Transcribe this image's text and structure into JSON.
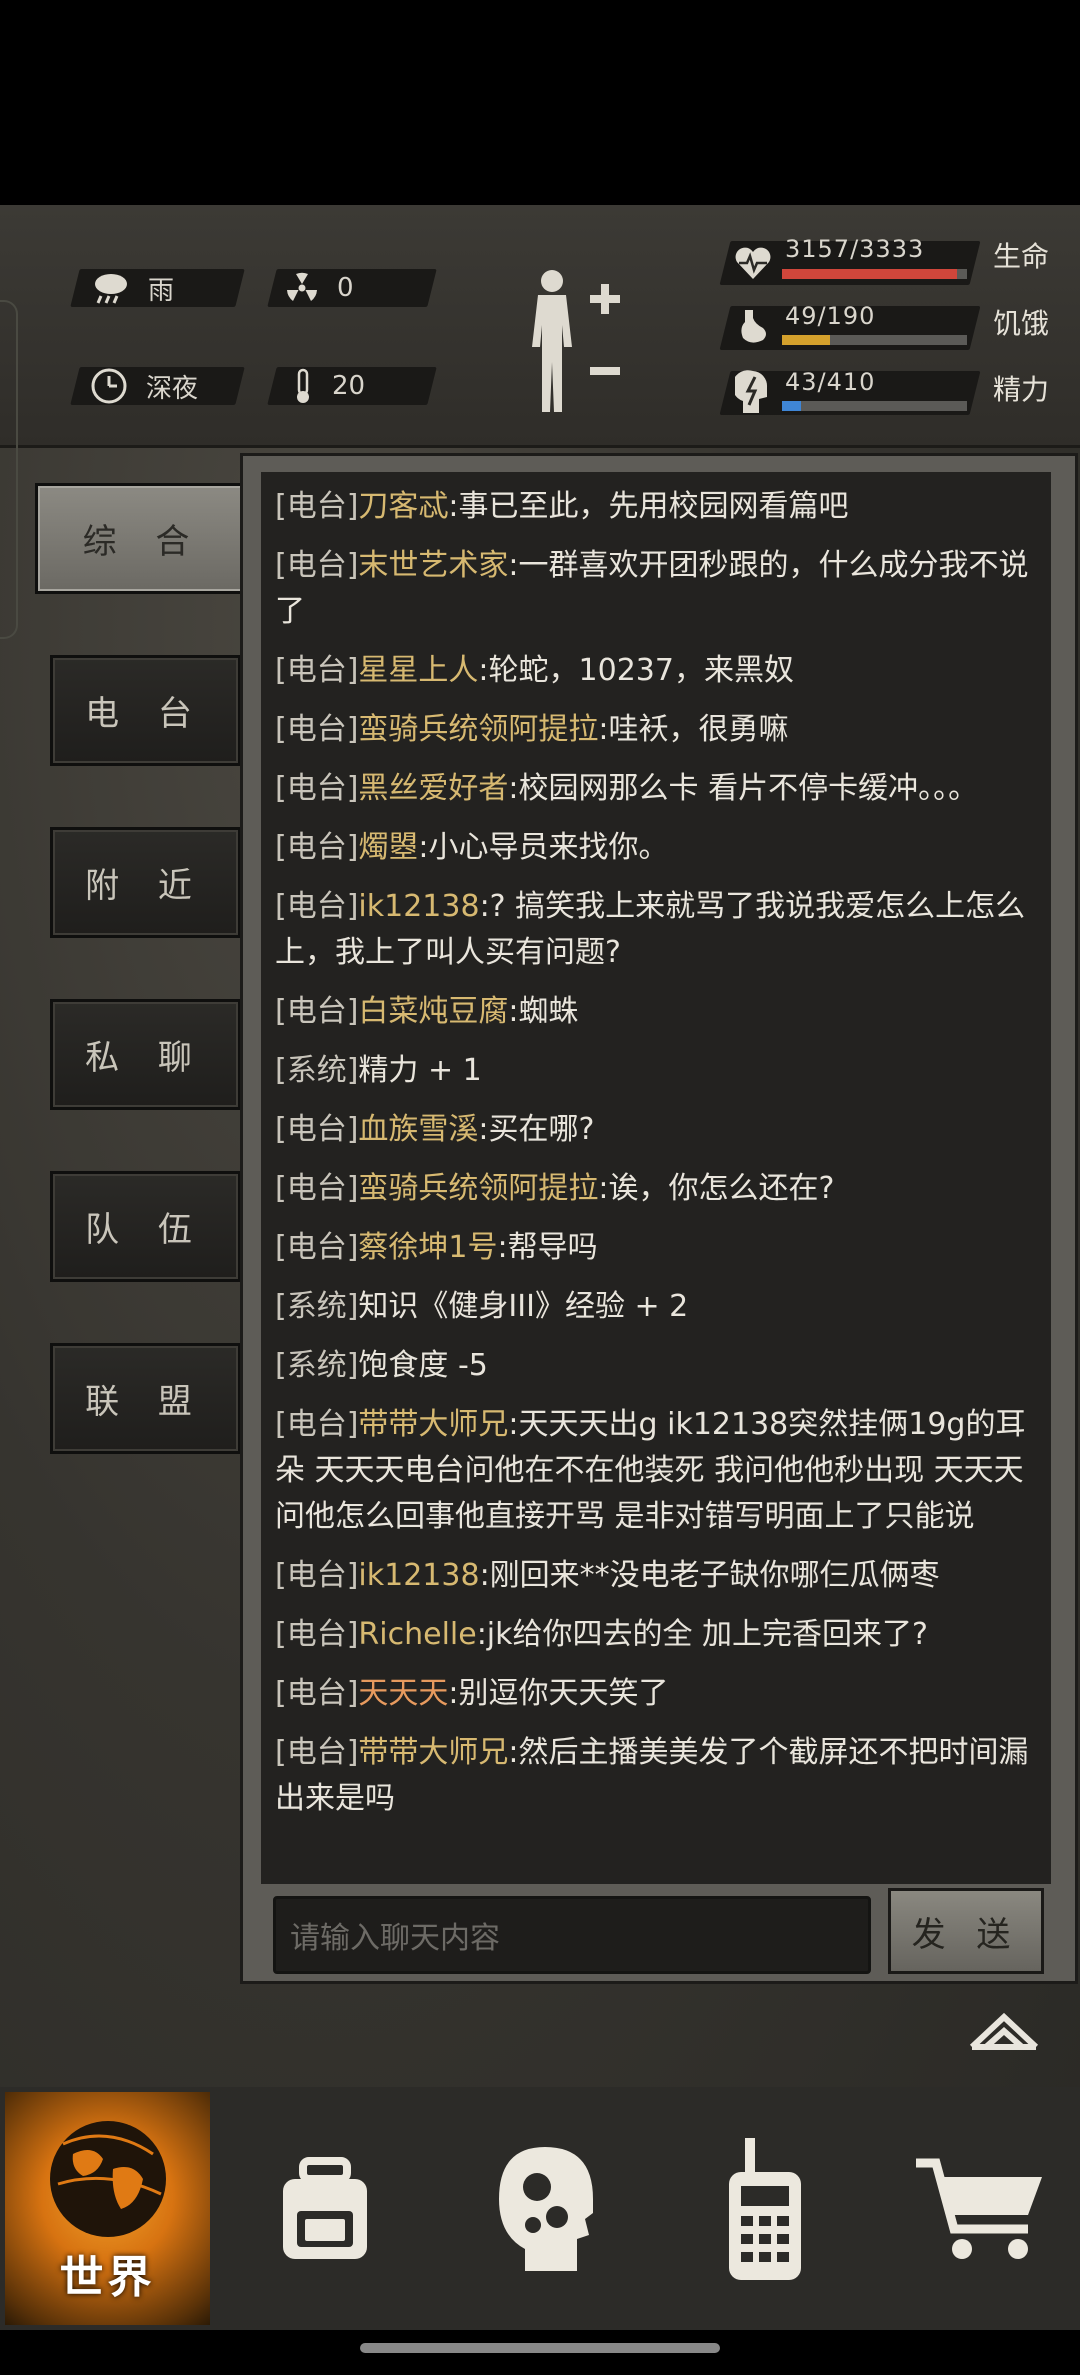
{
  "status": {
    "weather": "雨",
    "radiation": "0",
    "time_of_day": "深夜",
    "temperature": "20",
    "health": {
      "value": "3157/3333",
      "label": "生命",
      "fraction": 0.947,
      "color": "#d0463b"
    },
    "hunger": {
      "value": "49/190",
      "label": "饥饿",
      "fraction": 0.258,
      "color": "#d4a02c"
    },
    "energy": {
      "value": "43/410",
      "label": "精力",
      "fraction": 0.105,
      "color": "#3f86d6"
    }
  },
  "tabs": [
    "综 合",
    "电 台",
    "附 近",
    "私 聊",
    "队 伍",
    "联 盟"
  ],
  "messages": [
    {
      "ch": "[电台]",
      "name": "刀客忒",
      "text": ":事已至此，先用校园网看篇吧"
    },
    {
      "ch": "[电台]",
      "name": "末世艺术家",
      "text": ":一群喜欢开团秒跟的，什么成分我不说了"
    },
    {
      "ch": "[电台]",
      "name": "星星上人",
      "text": ":轮蛇，10237，来黑奴"
    },
    {
      "ch": "[电台]",
      "name": "蛮骑兵统领阿提拉",
      "text": ":哇袄，很勇嘛"
    },
    {
      "ch": "[电台]",
      "name": "黑丝爱好者",
      "text": ":校园网那么卡 看片不停卡缓冲。。。"
    },
    {
      "ch": "[电台]",
      "name": "燭曌",
      "text": ":小心导员来找你。"
    },
    {
      "ch": "[电台]",
      "name": "ik12138",
      "text": ":? 搞笑我上来就骂了我说我爱怎么上怎么上，我上了叫人买有问题?"
    },
    {
      "ch": "[电台]",
      "name": "白菜炖豆腐",
      "text": ":蜘蛛"
    },
    {
      "ch": "[系统]",
      "name": "",
      "text": "精力 + 1"
    },
    {
      "ch": "[电台]",
      "name": "血族雪溪",
      "text": ":买在哪?"
    },
    {
      "ch": "[电台]",
      "name": "蛮骑兵统领阿提拉",
      "text": ":诶，你怎么还在?"
    },
    {
      "ch": "[电台]",
      "name": "蔡徐坤1号",
      "text": ":帮导吗"
    },
    {
      "ch": "[系统]",
      "name": "",
      "text": "知识《健身III》经验 + 2"
    },
    {
      "ch": "[系统]",
      "name": "",
      "text": "饱食度 -5"
    },
    {
      "ch": "[电台]",
      "name": "带带大师兄",
      "text": ":天天天出g ik12138突然挂俩19g的耳朵 天天天电台问他在不在他装死 我问他他秒出现 天天天问他怎么回事他直接开骂 是非对错写明面上了只能说"
    },
    {
      "ch": "[电台]",
      "name": "ik12138",
      "text": ":刚回来**没电老子缺你哪仨瓜俩枣"
    },
    {
      "ch": "[电台]",
      "name": "Richelle",
      "text": ":jk给你四去的全 加上完香回来了?"
    },
    {
      "ch": "[电台]",
      "name": "天天天",
      "text": ":别逗你天天笑了",
      "orange": true
    },
    {
      "ch": "[电台]",
      "name": "带带大师兄",
      "text": ":然后主播美美发了个截屏还不把时间漏出来是吗"
    }
  ],
  "input": {
    "placeholder": "请输入聊天内容"
  },
  "send_label": "发 送",
  "nav": {
    "world_label": "世界"
  }
}
